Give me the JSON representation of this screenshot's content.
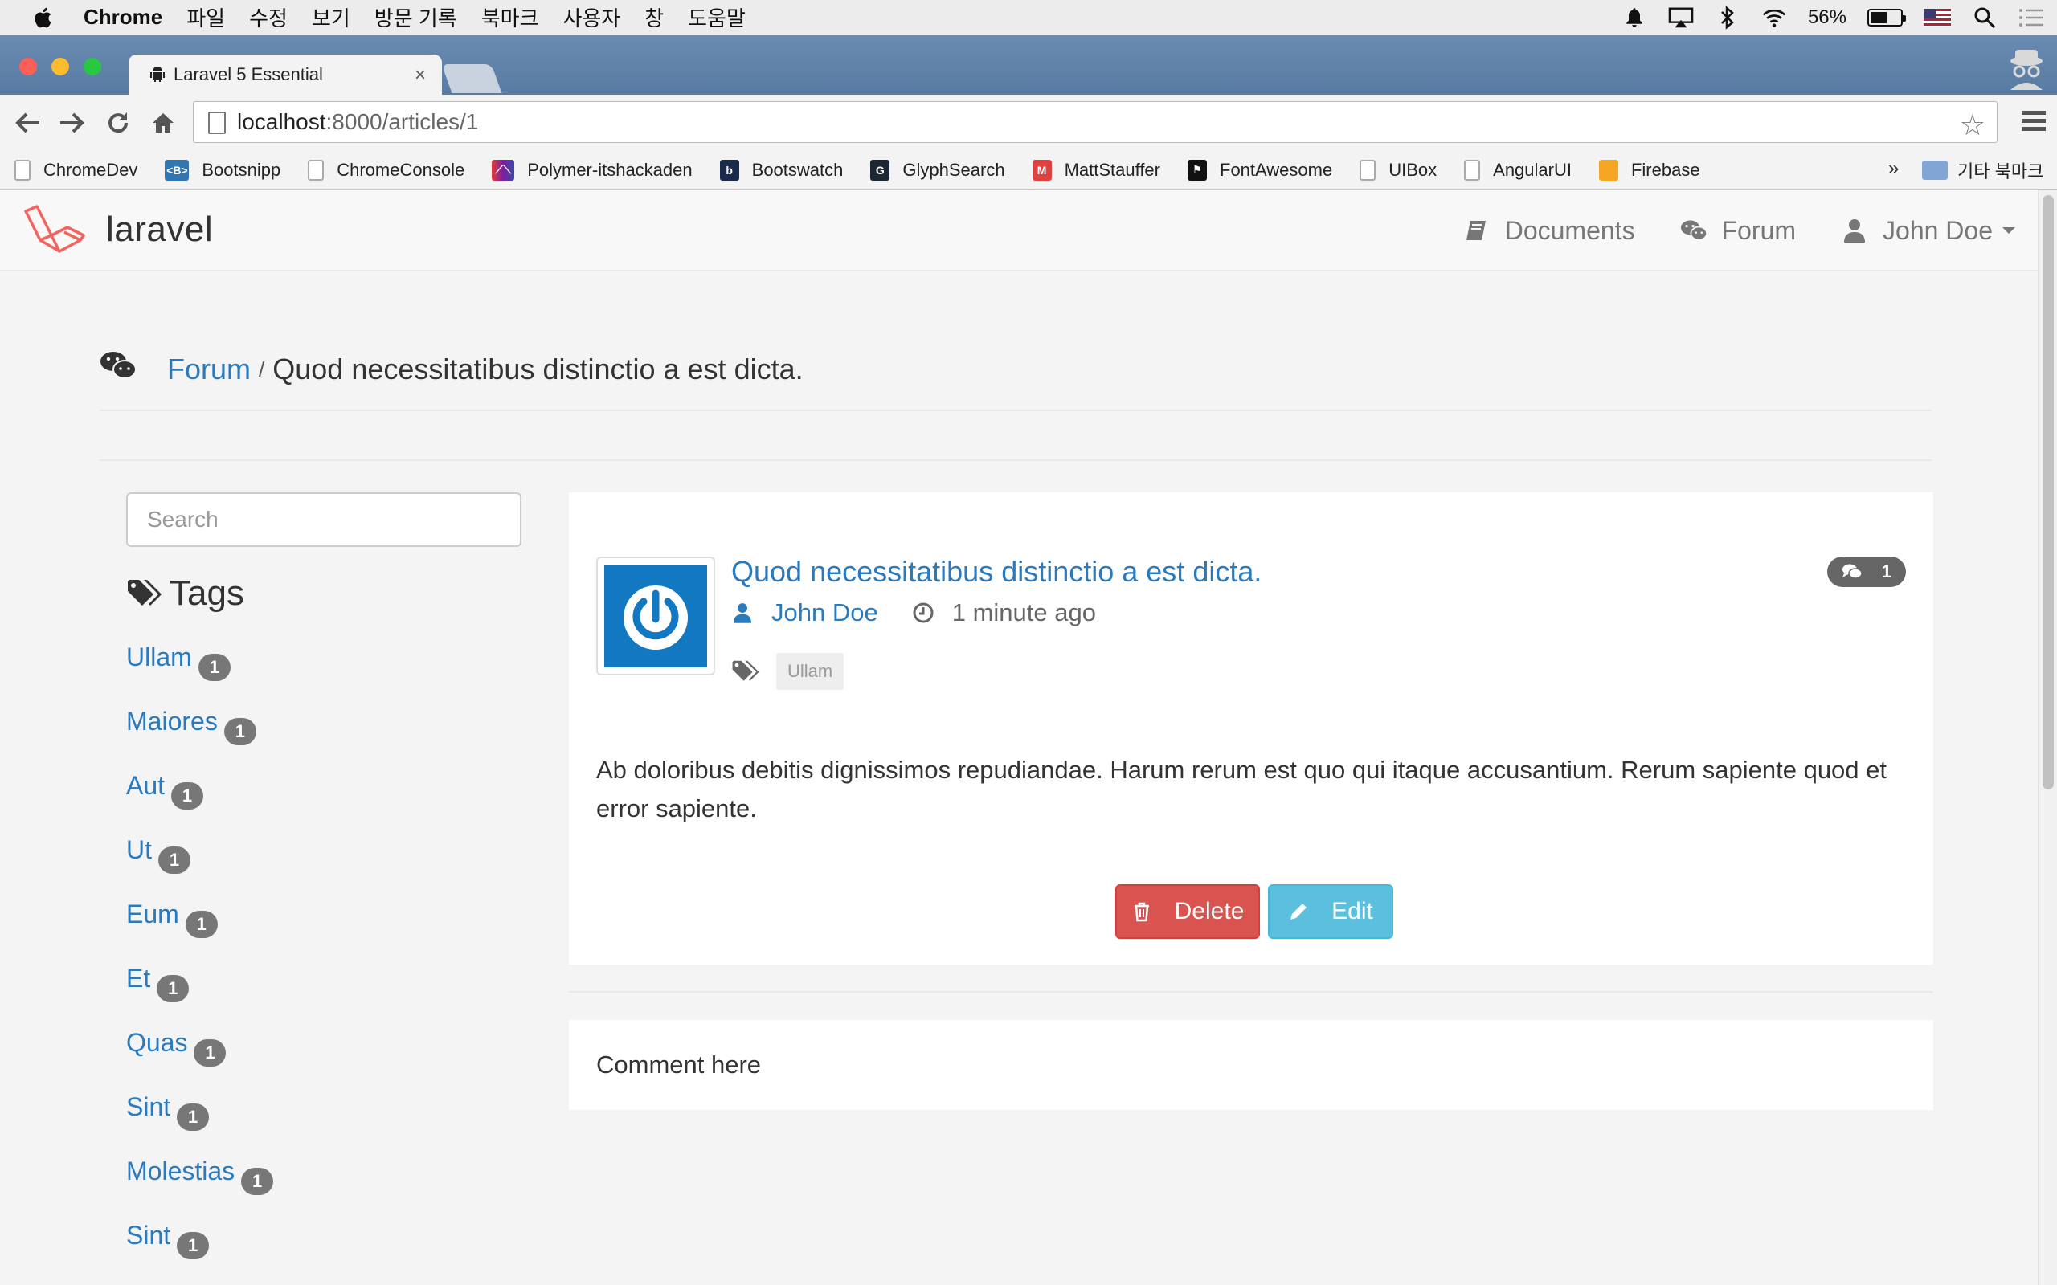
{
  "menubar": {
    "app": "Chrome",
    "items": [
      "파일",
      "수정",
      "보기",
      "방문 기록",
      "북마크",
      "사용자",
      "창",
      "도움말"
    ],
    "battery": "56%",
    "battery_fraction": 0.56
  },
  "browser": {
    "tab_title": "Laravel 5 Essential",
    "tab_close": "×",
    "url_host": "localhost",
    "url_rest": ":8000/articles/1",
    "star": "☆",
    "bookmarks": [
      {
        "label": "ChromeDev",
        "icon": "page-icon"
      },
      {
        "label": "Bootsnipp",
        "icon": "bootsnipp-icon"
      },
      {
        "label": "ChromeConsole",
        "icon": "page-icon"
      },
      {
        "label": "Polymer-itshackaden",
        "icon": "polymer-icon"
      },
      {
        "label": "Bootswatch",
        "icon": "bootswatch-icon"
      },
      {
        "label": "GlyphSearch",
        "icon": "glyphsearch-icon"
      },
      {
        "label": "MattStauffer",
        "icon": "mattstauffer-icon"
      },
      {
        "label": "FontAwesome",
        "icon": "fontawesome-icon"
      },
      {
        "label": "UIBox",
        "icon": "page-icon"
      },
      {
        "label": "AngularUI",
        "icon": "page-icon"
      },
      {
        "label": "Firebase",
        "icon": "firebase-icon"
      }
    ],
    "more": "»",
    "other_bookmarks": "기타 북마크"
  },
  "navbar": {
    "brand": "laravel",
    "documents": "Documents",
    "forum": "Forum",
    "user": "John Doe"
  },
  "breadcrumb": {
    "link": "Forum",
    "separator": "/",
    "title": "Quod necessitatibus distinctio a est dicta."
  },
  "sidebar": {
    "search_placeholder": "Search",
    "tags_heading": "Tags",
    "tags": [
      {
        "name": "Ullam",
        "count": "1"
      },
      {
        "name": "Maiores",
        "count": "1"
      },
      {
        "name": "Aut",
        "count": "1"
      },
      {
        "name": "Ut",
        "count": "1"
      },
      {
        "name": "Eum",
        "count": "1"
      },
      {
        "name": "Et",
        "count": "1"
      },
      {
        "name": "Quas",
        "count": "1"
      },
      {
        "name": "Sint",
        "count": "1"
      },
      {
        "name": "Molestias",
        "count": "1"
      },
      {
        "name": "Sint",
        "count": "1"
      }
    ]
  },
  "article": {
    "title": "Quod necessitatibus distinctio a est dicta.",
    "author": "John Doe",
    "time": "1 minute ago",
    "tag": "Ullam",
    "comment_count": "1",
    "body": "Ab doloribus debitis dignissimos repudiandae. Harum rerum est quo qui itaque accusantium. Rerum sapiente quod et error sapiente.",
    "delete_label": "Delete",
    "edit_label": "Edit"
  },
  "comment": {
    "label": "Comment here"
  },
  "colors": {
    "link": "#2a7abf",
    "danger": "#d9534f",
    "info": "#5bc0de",
    "badge": "#777777",
    "laravel_red": "#f4645f"
  }
}
